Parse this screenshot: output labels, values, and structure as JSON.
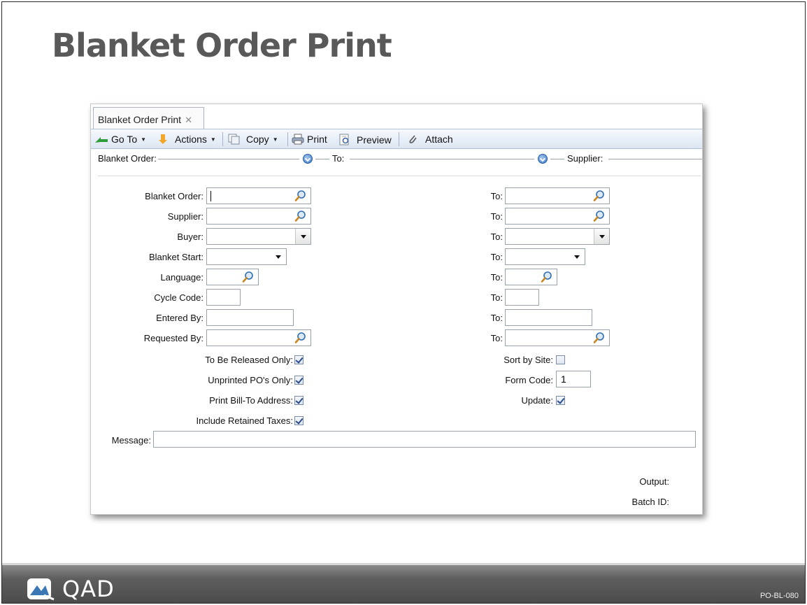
{
  "slide": {
    "title": "Blanket Order Print",
    "brand": "QAD",
    "code": "PO-BL-080"
  },
  "window": {
    "tab_label": "Blanket Order Print",
    "tab_close": "✕",
    "toolbar": {
      "goto": "Go To",
      "actions": "Actions",
      "copy": "Copy",
      "print": "Print",
      "preview": "Preview",
      "attach": "Attach"
    },
    "criteria": {
      "blanket_order": "Blanket Order:",
      "to": "To:",
      "supplier": "Supplier:"
    }
  },
  "form": {
    "blanket_order_label": "Blanket Order:",
    "supplier_label": "Supplier:",
    "buyer_label": "Buyer:",
    "blanket_start_label": "Blanket Start:",
    "language_label": "Language:",
    "cycle_code_label": "Cycle Code:",
    "entered_by_label": "Entered By:",
    "requested_by_label": "Requested By:",
    "to_label": "To:",
    "to_be_released_label": "To Be Released Only:",
    "unprinted_label": "Unprinted PO's Only:",
    "bill_to_label": "Print Bill-To Address:",
    "retained_taxes_label": "Include Retained Taxes:",
    "sort_by_site_label": "Sort by Site:",
    "form_code_label": "Form Code:",
    "form_code_value": "1",
    "update_label": "Update:",
    "message_label": "Message:",
    "output_label": "Output:",
    "batch_id_label": "Batch ID:",
    "checkboxes": {
      "to_be_released": true,
      "unprinted": true,
      "bill_to": true,
      "retained_taxes": true,
      "sort_by_site": false,
      "update": true
    }
  },
  "colors": {
    "title": "#595959",
    "toolbar_top": "#f6f9fd",
    "toolbar_bottom": "#dce6f3",
    "footer": "#4c4c4c",
    "accent": "#3d78c8"
  }
}
